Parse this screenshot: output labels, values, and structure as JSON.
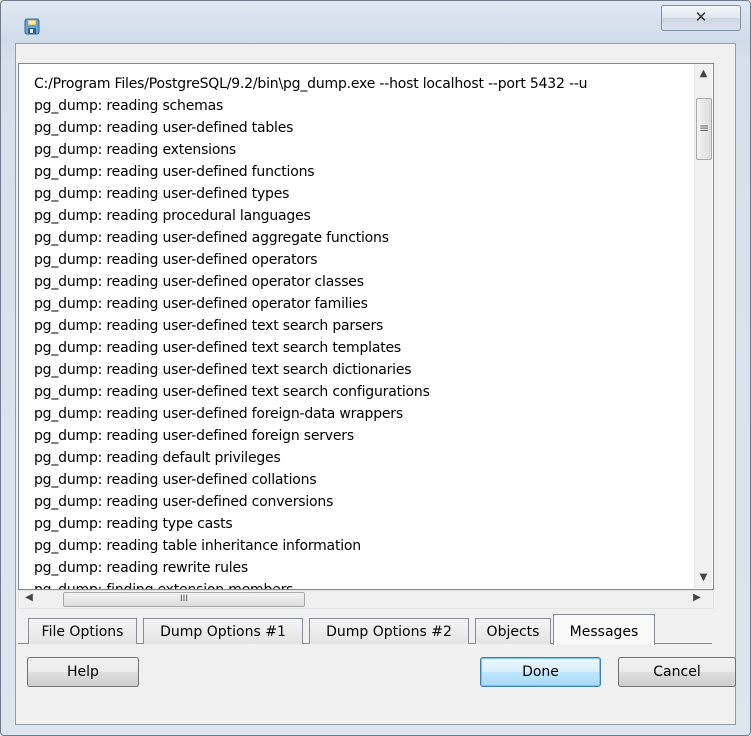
{
  "window": {
    "close_glyph": "✕",
    "icon": "database-save-icon"
  },
  "messages": {
    "lines": [
      "C:/Program Files/PostgreSQL/9.2/bin\\pg_dump.exe --host localhost --port 5432 --u",
      "pg_dump: reading schemas",
      "pg_dump: reading user-defined tables",
      "pg_dump: reading extensions",
      "pg_dump: reading user-defined functions",
      "pg_dump: reading user-defined types",
      "pg_dump: reading procedural languages",
      "pg_dump: reading user-defined aggregate functions",
      "pg_dump: reading user-defined operators",
      "pg_dump: reading user-defined operator classes",
      "pg_dump: reading user-defined operator families",
      "pg_dump: reading user-defined text search parsers",
      "pg_dump: reading user-defined text search templates",
      "pg_dump: reading user-defined text search dictionaries",
      "pg_dump: reading user-defined text search configurations",
      "pg_dump: reading user-defined foreign-data wrappers",
      "pg_dump: reading user-defined foreign servers",
      "pg_dump: reading default privileges",
      "pg_dump: reading user-defined collations",
      "pg_dump: reading user-defined conversions",
      "pg_dump: reading type casts",
      "pg_dump: reading table inheritance information",
      "pg_dump: reading rewrite rules",
      "pg_dump: finding extension members"
    ]
  },
  "scrollbars": {
    "up_arrow": "▲",
    "down_arrow": "▼",
    "left_arrow": "◀",
    "right_arrow": "▶",
    "grip": "III",
    "v_grip": "≡"
  },
  "tabs": [
    {
      "label": "File Options"
    },
    {
      "label": "Dump Options #1"
    },
    {
      "label": "Dump Options #2"
    },
    {
      "label": "Objects"
    },
    {
      "label": "Messages",
      "active": true
    }
  ],
  "buttons": {
    "help": "Help",
    "done": "Done",
    "cancel": "Cancel"
  }
}
